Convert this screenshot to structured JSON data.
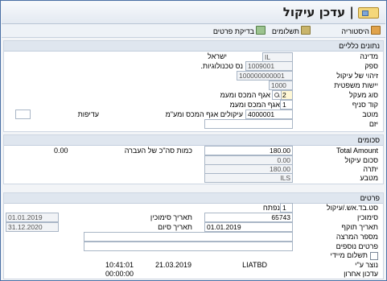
{
  "header": {
    "title": "צור | עדכן עיקול"
  },
  "toolbar": {
    "history": "היסטוריה",
    "payments": "תשלומים",
    "check": "בדיקת פרטים"
  },
  "general": {
    "heading": "נתונים כלליים",
    "country_label": "מדינה",
    "country_code": "IL",
    "country_name": "ישראל",
    "supplier_label": "ספק",
    "supplier_value": "1009001",
    "supplier_name": "נס טכנולוגיות.",
    "garn_id_label": "זיהוי של עיקול",
    "garn_id_value": "100000000001",
    "legal_label": "יישות משפטית",
    "legal_value": "1000",
    "dep_type_label": "סוג מעקל",
    "dep_type_value": "2",
    "dep_type_text": "אגף המכס ומעמ",
    "branch_label": "קוד סניף",
    "branch_value": "1",
    "branch_text": "אגף המכס ומעמ",
    "recipient_label": "מוטב",
    "recipient_value": "4000001",
    "recipient_text": "עיקולים אגף המכס ומע\"מ",
    "priority_label": "עדיפות",
    "priority_value": "",
    "initiator_label": "יזם",
    "initiator_value": ""
  },
  "amounts": {
    "heading": "סכומים",
    "total_label": "Total Amount",
    "total_value": "180.00",
    "transfer_label": "כמות סה\"כ של העברה",
    "transfer_value": "0.00",
    "garn_amount_label": "סכום עיקול",
    "garn_amount_value": "0.00",
    "balance_label": "יתרה",
    "balance_value": "180.00",
    "currency_label": "מטבע",
    "currency_value": "ILS"
  },
  "details": {
    "heading": "פרטים",
    "status_label": "סט.בד.אש./עיקול",
    "status_value": "1",
    "status_text": "נפתח",
    "ref_label": "סימוכין",
    "ref_value": "65743",
    "ref_date_label": "תאריך סימוכין",
    "ref_date_value": "01.01.2019",
    "valid_label": "תאריך תוקף",
    "valid_value": "01.01.2019",
    "end_label": "תאריך סיום",
    "end_value": "31.12.2020",
    "warn_label": "מספר המרצה",
    "warn_value": "",
    "more_label": "פרטים נוספים",
    "more_value": "",
    "immediate_label": "תשלום מיידי",
    "created_label": "נוצר ע\"י",
    "created_by": "LIATBD",
    "created_date": "21.03.2019",
    "created_time": "10:41:01",
    "updated_label": "עדכון אחרון",
    "updated_time": "00:00:00"
  }
}
